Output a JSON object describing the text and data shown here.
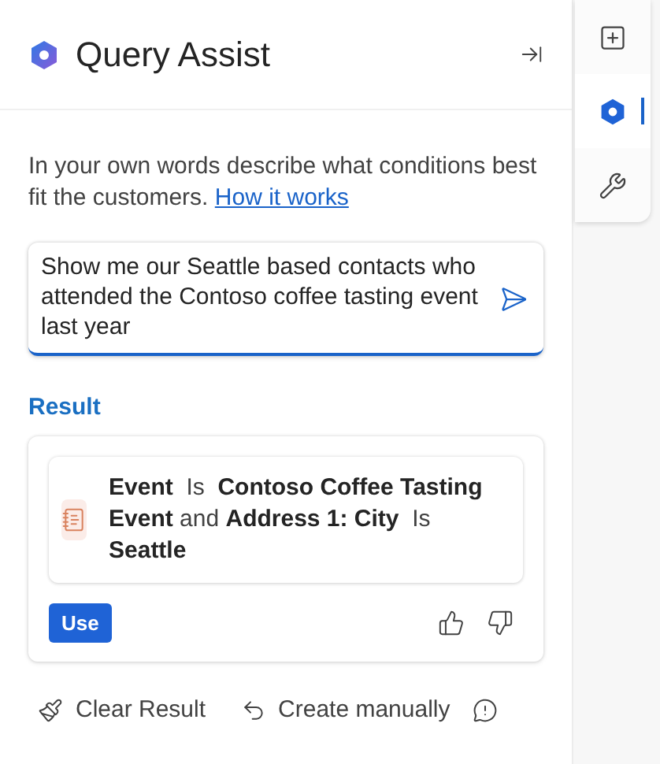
{
  "header": {
    "title": "Query Assist"
  },
  "description": {
    "text": "In your own words describe what conditions best fit the customers.",
    "link": "How it works"
  },
  "query": {
    "value": "Show me our Seattle based contacts who attended the Contoso coffee tasting event last year",
    "focused": true
  },
  "result": {
    "heading": "Result",
    "condition": "**Event**  Is  **Contoso Coffee Tasting Event** and **Address 1: City**  Is  **Seattle**",
    "use_button": "Use"
  },
  "footer_actions": [
    {
      "label": "Clear Result",
      "kind": "clear"
    },
    {
      "label": "Create manually",
      "kind": "manual"
    }
  ],
  "side_tabs": [
    {
      "kind": "add",
      "selected": false
    },
    {
      "kind": "copilot",
      "selected": true
    },
    {
      "kind": "tools",
      "selected": false
    }
  ]
}
